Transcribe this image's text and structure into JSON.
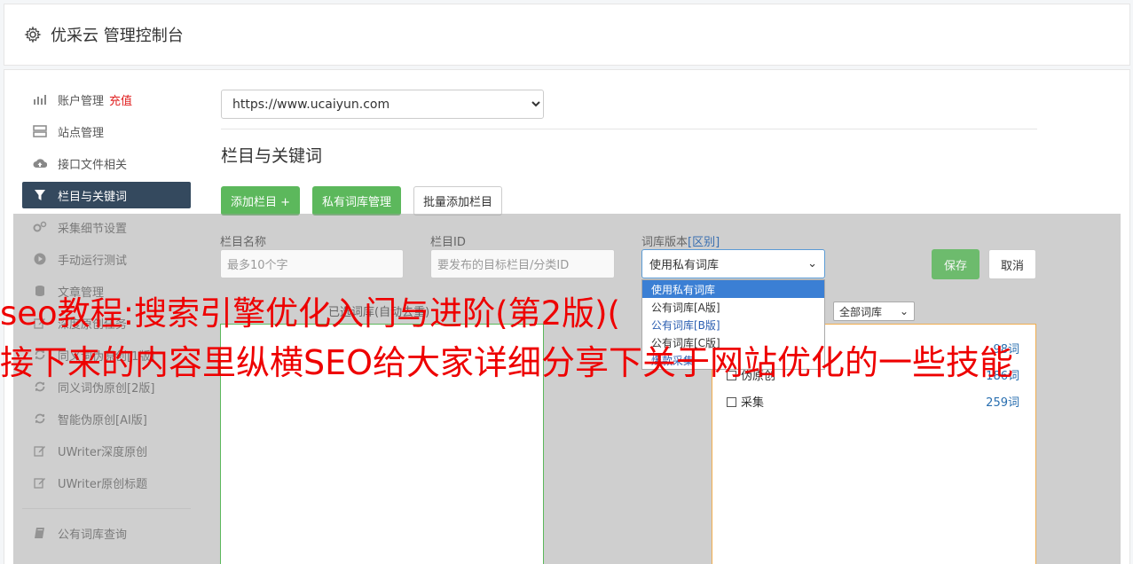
{
  "header": {
    "title": "优采云 管理控制台"
  },
  "sidebar": {
    "items": [
      {
        "label": "账户管理",
        "extra": "充值"
      },
      {
        "label": "站点管理"
      },
      {
        "label": "接口文件相关"
      },
      {
        "label": "栏目与关键词"
      },
      {
        "label": "采集细节设置"
      },
      {
        "label": "手动运行测试"
      },
      {
        "label": "文章管理"
      },
      {
        "label": "深度原创任务"
      },
      {
        "label": "同义词伪原创[1版]"
      },
      {
        "label": "同义词伪原创[2版]"
      },
      {
        "label": "智能伪原创[AI版]"
      },
      {
        "label": "UWriter深度原创"
      },
      {
        "label": "UWriter原创标题"
      },
      {
        "label": "公有词库查询"
      }
    ]
  },
  "site_select": {
    "value": "https://www.ucaiyun.com"
  },
  "section": {
    "title": "栏目与关键词"
  },
  "buttons": {
    "add_column": "添加栏目 +",
    "private_lib": "私有词库管理",
    "batch_add": "批量添加栏目"
  },
  "form": {
    "name_label": "栏目名称",
    "name_placeholder": "最多10个字",
    "id_label": "栏目ID",
    "id_placeholder": "要发布的目标栏目/分类ID",
    "version_label": "词库版本",
    "version_link": "[区别]",
    "version_value": "使用私有词库",
    "save": "保存",
    "cancel": "取消"
  },
  "dropdown": {
    "options": [
      "使用私有词库",
      "公有词库[A版]",
      "公有词库[B版]",
      "公有词库[C版]",
      "爆款采集"
    ]
  },
  "panels": {
    "left_header": "已选词库(自动去重)",
    "filter_value": "全部词库",
    "libs": [
      {
        "name": "",
        "count": "98词"
      },
      {
        "name": "伪原创",
        "count": "186词"
      },
      {
        "name": "采集",
        "count": "259词"
      }
    ]
  },
  "watermark": {
    "line1": "seo教程:搜索引擎优化入门与进阶(第2版)(",
    "line2": "接下来的内容里纵横SEO给大家详细分享下关于网站优化的一些技能"
  }
}
